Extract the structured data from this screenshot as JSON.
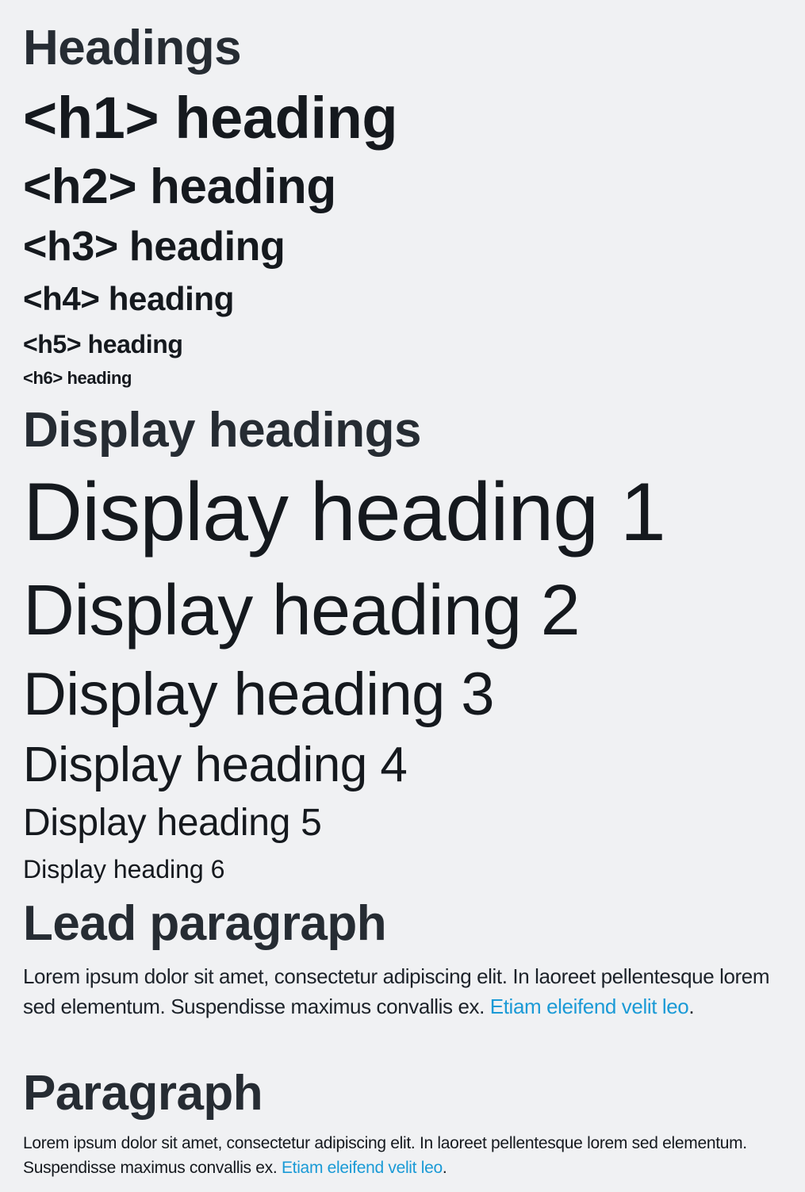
{
  "sections": {
    "headings_title": "Headings",
    "display_title": "Display headings",
    "lead_title": "Lead paragraph",
    "paragraph_title": "Paragraph"
  },
  "headings": {
    "h1": "<h1> heading",
    "h2": "<h2> heading",
    "h3": "<h3> heading",
    "h4": "<h4> heading",
    "h5": "<h5> heading",
    "h6": "<h6> heading"
  },
  "display": {
    "d1": "Display heading 1",
    "d2": "Display heading 2",
    "d3": "Display heading 3",
    "d4": "Display heading 4",
    "d5": "Display heading 5",
    "d6": "Display heading 6"
  },
  "lead": {
    "text": "Lorem ipsum dolor sit amet, consectetur adipiscing elit. In laoreet pellentesque lorem sed elementum. Suspendisse maximus convallis ex. ",
    "link": "Etiam eleifend velit leo",
    "end": "."
  },
  "paragraph": {
    "text": "Lorem ipsum dolor sit amet, consectetur adipiscing elit. In laoreet pellentesque lorem sed elementum. Suspendisse maximus convallis ex. ",
    "link": "Etiam eleifend velit leo",
    "end": "."
  },
  "colors": {
    "background": "#f0f1f3",
    "text": "#15191e",
    "link": "#1a9ad6"
  }
}
